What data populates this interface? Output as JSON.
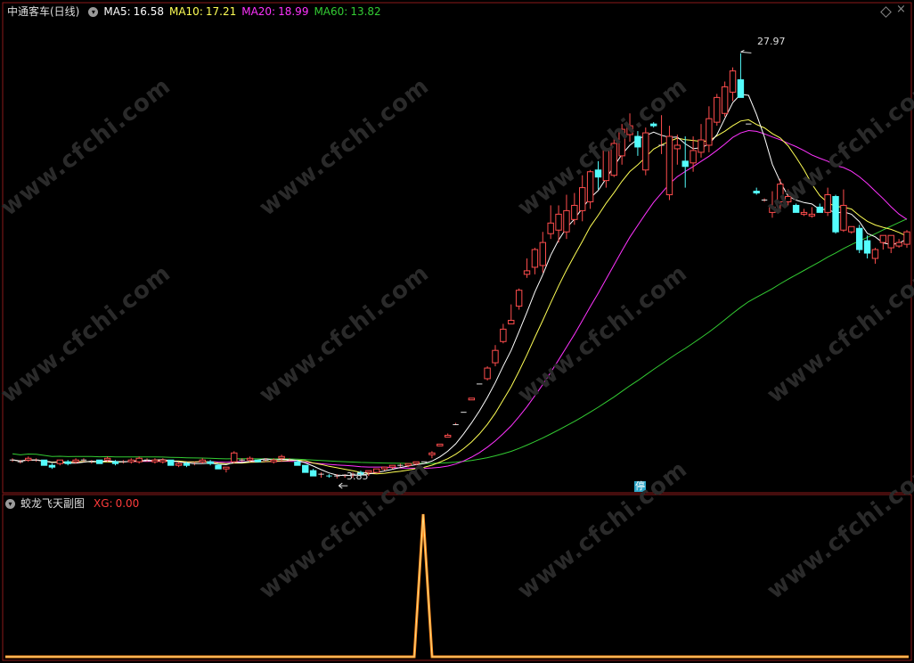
{
  "header": {
    "title": "中通客车(日线)",
    "ma5_label": "MA5:",
    "ma5": "16.58",
    "ma10_label": "MA10:",
    "ma10": "17.21",
    "ma20_label": "MA20:",
    "ma20": "18.99",
    "ma60_label": "MA60:",
    "ma60": "13.82"
  },
  "sub_header": {
    "title": "蛟龙飞天副图",
    "xg_label": "XG:",
    "xg": "0.00"
  },
  "annotations": {
    "high": "27.97",
    "low": "3.85",
    "limit_tag": "停"
  },
  "watermark": "www.cfchi.com",
  "colors": {
    "up": "#ff4d4d",
    "down": "#54fcfc",
    "ma5": "#ffffff",
    "ma10": "#ffff55",
    "ma20": "#ff33ff",
    "ma60": "#33cc33",
    "signal": "#ff8a1c"
  },
  "chart_data": [
    {
      "type": "candlestick",
      "title": "中通客车(日线)",
      "y_range": [
        3.3,
        29.5
      ],
      "indicators": [
        {
          "name": "MA5",
          "value": 16.58
        },
        {
          "name": "MA10",
          "value": 17.21
        },
        {
          "name": "MA20",
          "value": 18.99
        },
        {
          "name": "MA60",
          "value": 13.82
        }
      ],
      "high": 27.97,
      "low": 3.85,
      "ohlc_approx": [
        [
          4.9,
          5.0,
          4.8,
          4.9
        ],
        [
          4.8,
          4.9,
          4.7,
          4.8
        ],
        [
          4.9,
          5.1,
          4.8,
          5.0
        ],
        [
          4.9,
          5.0,
          4.8,
          4.9
        ],
        [
          4.9,
          4.9,
          4.6,
          4.6
        ],
        [
          4.6,
          4.7,
          4.4,
          4.5
        ],
        [
          4.7,
          4.9,
          4.6,
          4.9
        ],
        [
          4.8,
          4.9,
          4.6,
          4.7
        ],
        [
          4.8,
          5.0,
          4.7,
          4.9
        ],
        [
          4.9,
          5.0,
          4.8,
          4.9
        ],
        [
          4.8,
          4.9,
          4.7,
          4.8
        ],
        [
          4.9,
          4.9,
          4.7,
          4.7
        ],
        [
          4.9,
          5.1,
          4.8,
          5.0
        ],
        [
          4.8,
          4.9,
          4.6,
          4.7
        ],
        [
          4.8,
          4.9,
          4.7,
          4.8
        ],
        [
          4.8,
          5.0,
          4.7,
          4.9
        ],
        [
          4.8,
          5.1,
          4.7,
          5.0
        ],
        [
          4.9,
          5.0,
          4.8,
          4.9
        ],
        [
          4.8,
          5.0,
          4.7,
          4.9
        ],
        [
          4.8,
          5.0,
          4.7,
          4.9
        ],
        [
          4.9,
          4.9,
          4.6,
          4.6
        ],
        [
          4.6,
          4.8,
          4.5,
          4.7
        ],
        [
          4.7,
          4.8,
          4.5,
          4.6
        ],
        [
          4.7,
          4.8,
          4.6,
          4.7
        ],
        [
          4.8,
          5.0,
          4.7,
          4.9
        ],
        [
          4.8,
          4.9,
          4.6,
          4.7
        ],
        [
          4.6,
          4.7,
          4.4,
          4.4
        ],
        [
          4.4,
          4.5,
          4.2,
          4.5
        ],
        [
          4.8,
          5.4,
          4.7,
          5.3
        ],
        [
          4.9,
          5.0,
          4.8,
          4.9
        ],
        [
          4.9,
          5.1,
          4.8,
          5.0
        ],
        [
          4.9,
          4.9,
          4.8,
          4.8
        ],
        [
          4.9,
          5.0,
          4.8,
          4.9
        ],
        [
          4.8,
          5.0,
          4.7,
          4.9
        ],
        [
          5.0,
          5.2,
          4.8,
          5.1
        ],
        [
          4.9,
          5.0,
          4.8,
          4.9
        ],
        [
          4.8,
          4.9,
          4.6,
          4.6
        ],
        [
          4.6,
          4.6,
          4.2,
          4.2
        ],
        [
          4.3,
          4.4,
          4.0,
          4.0
        ],
        [
          4.1,
          4.2,
          3.9,
          4.1
        ],
        [
          4.0,
          4.1,
          3.9,
          3.95
        ],
        [
          3.95,
          4.1,
          3.85,
          4.0
        ],
        [
          4.0,
          4.1,
          3.9,
          4.05
        ],
        [
          4.1,
          4.2,
          3.9,
          4.1
        ],
        [
          4.2,
          4.3,
          4.0,
          4.1
        ],
        [
          4.2,
          4.3,
          4.0,
          4.3
        ],
        [
          4.2,
          4.4,
          4.2,
          4.4
        ],
        [
          4.4,
          4.5,
          4.3,
          4.5
        ],
        [
          4.5,
          4.6,
          4.4,
          4.6
        ],
        [
          4.6,
          4.7,
          4.5,
          4.6
        ],
        [
          4.6,
          4.7,
          4.5,
          4.7
        ],
        [
          4.7,
          4.8,
          4.6,
          4.8
        ],
        [
          4.8,
          4.8,
          4.8,
          4.8
        ],
        [
          5.2,
          5.4,
          5.0,
          5.3
        ],
        [
          5.7,
          5.8,
          5.7,
          5.8
        ],
        [
          6.2,
          6.4,
          6.2,
          6.3
        ],
        [
          6.9,
          7.0,
          6.9,
          6.9
        ],
        [
          7.6,
          7.6,
          7.6,
          7.6
        ],
        [
          8.3,
          8.4,
          8.3,
          8.4
        ],
        [
          9.2,
          9.2,
          9.2,
          9.2
        ],
        [
          9.5,
          10.2,
          9.4,
          10.1
        ],
        [
          10.4,
          11.4,
          10.2,
          11.1
        ],
        [
          11.6,
          12.6,
          11.5,
          12.3
        ],
        [
          12.6,
          13.7,
          12.6,
          12.8
        ],
        [
          13.6,
          14.6,
          13.4,
          14.5
        ],
        [
          15.4,
          16.3,
          15.2,
          15.6
        ],
        [
          15.8,
          16.9,
          15.4,
          16.8
        ],
        [
          15.9,
          17.8,
          15.5,
          17.2
        ],
        [
          17.7,
          19.3,
          17.4,
          18.3
        ],
        [
          17.9,
          19.3,
          17.2,
          18.8
        ],
        [
          17.8,
          19.9,
          17.4,
          19.0
        ],
        [
          18.5,
          20.0,
          18.2,
          19.3
        ],
        [
          19.0,
          21.0,
          18.4,
          20.3
        ],
        [
          19.5,
          21.3,
          19.1,
          21.2
        ],
        [
          21.3,
          21.8,
          20.2,
          20.9
        ],
        [
          20.7,
          22.5,
          20.3,
          22.4
        ],
        [
          21.0,
          23.1,
          20.9,
          22.8
        ],
        [
          22.1,
          23.9,
          21.6,
          23.6
        ],
        [
          23.3,
          24.5,
          22.9,
          23.8
        ],
        [
          23.2,
          23.5,
          22.1,
          22.6
        ],
        [
          21.3,
          23.7,
          21.0,
          23.4
        ],
        [
          23.9,
          24.0,
          23.7,
          23.8
        ],
        [
          22.7,
          24.4,
          22.2,
          22.7
        ],
        [
          19.9,
          23.8,
          19.6,
          23.2
        ],
        [
          22.5,
          23.3,
          21.6,
          22.7
        ],
        [
          21.8,
          23.2,
          20.3,
          21.5
        ],
        [
          21.7,
          23.2,
          21.2,
          22.4
        ],
        [
          22.3,
          23.9,
          22.0,
          23.0
        ],
        [
          22.7,
          24.9,
          22.3,
          24.2
        ],
        [
          24.0,
          25.6,
          23.8,
          25.4
        ],
        [
          24.5,
          26.3,
          24.3,
          26.0
        ],
        [
          25.7,
          27.1,
          25.2,
          26.9
        ],
        [
          26.4,
          27.9,
          26.0,
          25.4
        ],
        [
          23.9,
          23.9,
          23.9,
          23.9
        ],
        [
          20.1,
          20.3,
          19.9,
          20.0
        ],
        [
          19.6,
          19.7,
          19.5,
          19.6
        ],
        [
          18.9,
          20.1,
          18.6,
          19.2
        ],
        [
          19.5,
          20.8,
          19.0,
          20.5
        ],
        [
          19.5,
          20.2,
          19.3,
          19.8
        ],
        [
          19.3,
          19.4,
          18.9,
          18.9
        ],
        [
          18.8,
          19.1,
          18.7,
          18.9
        ],
        [
          18.7,
          19.2,
          18.6,
          18.8
        ],
        [
          19.2,
          19.4,
          18.9,
          18.9
        ],
        [
          18.9,
          20.3,
          18.7,
          19.9
        ],
        [
          19.8,
          19.9,
          17.7,
          17.8
        ],
        [
          17.9,
          20.2,
          17.8,
          19.3
        ],
        [
          17.8,
          18.1,
          17.7,
          18.1
        ],
        [
          18.0,
          18.2,
          16.6,
          16.8
        ],
        [
          17.3,
          17.6,
          16.3,
          16.6
        ],
        [
          16.3,
          16.9,
          16.0,
          16.8
        ],
        [
          17.2,
          17.6,
          16.8,
          17.6
        ],
        [
          16.9,
          17.6,
          16.6,
          17.6
        ],
        [
          17.0,
          17.4,
          16.9,
          17.2
        ],
        [
          17.1,
          17.9,
          16.9,
          17.8
        ]
      ]
    },
    {
      "type": "line",
      "title": "蛟龙飞天副图",
      "series": [
        {
          "name": "XG",
          "value": 0.0
        }
      ],
      "signal_note": "single spike"
    }
  ]
}
